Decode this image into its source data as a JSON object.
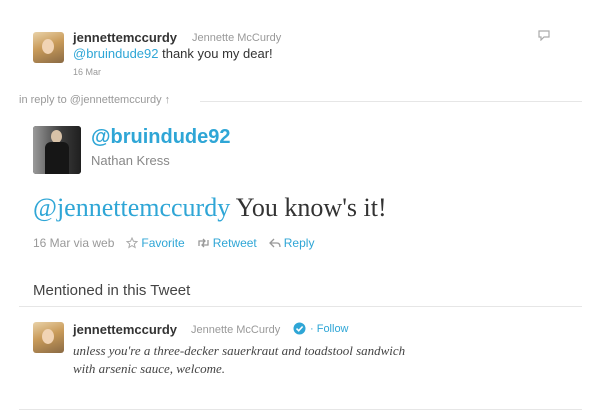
{
  "reply_tweet": {
    "screen_name": "jennettemccurdy",
    "full_name": "Jennette McCurdy",
    "mention": "@bruindude92",
    "text": " thank you my dear!",
    "date": "16 Mar"
  },
  "in_reply_to": "in reply to @jennettemccurdy ↑",
  "main_tweet": {
    "screen_name": "@bruindude92",
    "full_name": "Nathan Kress",
    "mention": "@jennettemccurdy",
    "text": " You know's it!",
    "meta": "16 Mar via web",
    "actions": {
      "favorite": "Favorite",
      "retweet": "Retweet",
      "reply": "Reply"
    }
  },
  "mentioned_section": {
    "title": "Mentioned in this Tweet",
    "user": {
      "screen_name": "jennettemccurdy",
      "full_name": "Jennette McCurdy",
      "follow_label": "· Follow",
      "bio_line1": "unless you're a three-decker sauerkraut and toadstool sandwich",
      "bio_line2": "with arsenic sauce, welcome."
    }
  },
  "colors": {
    "link": "#2fa6d6",
    "text": "#333333",
    "muted": "#999999"
  }
}
